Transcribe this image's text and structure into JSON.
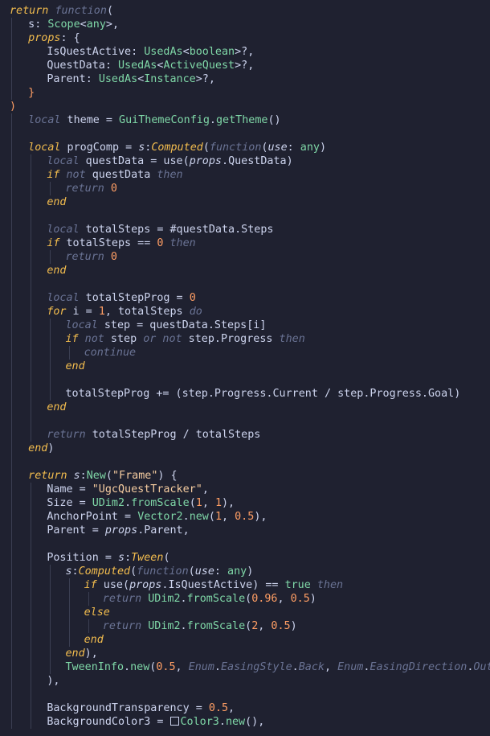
{
  "colors": {
    "background": "#1f2130",
    "text": "#cdd4ee",
    "keyword": "#f3bd4e",
    "muted_keyword": "#6a7394",
    "type": "#7fd7a7",
    "string": "#f5cca0",
    "number": "#ff9e64",
    "indent_guide": "#3b3f52"
  },
  "lines": [
    [
      [
        "return",
        "kw"
      ],
      [
        " "
      ],
      [
        "function",
        "kwd"
      ],
      [
        "("
      ]
    ],
    [
      [
        "s",
        "punc"
      ],
      [
        ": "
      ],
      [
        "Scope",
        "type"
      ],
      [
        "<"
      ],
      [
        "any",
        "type"
      ],
      [
        ">,"
      ]
    ],
    [
      [
        "props",
        "kw"
      ],
      [
        ": {"
      ]
    ],
    [
      [
        "IsQuestActive"
      ],
      [
        ": "
      ],
      [
        "UsedAs",
        "type"
      ],
      [
        "<"
      ],
      [
        "boolean",
        "type"
      ],
      [
        ">?,"
      ]
    ],
    [
      [
        "QuestData"
      ],
      [
        ": "
      ],
      [
        "UsedAs",
        "type"
      ],
      [
        "<"
      ],
      [
        "ActiveQuest",
        "type"
      ],
      [
        ">?,"
      ]
    ],
    [
      [
        "Parent"
      ],
      [
        ": "
      ],
      [
        "UsedAs",
        "type"
      ],
      [
        "<"
      ],
      [
        "Instance",
        "type"
      ],
      [
        ">?,"
      ]
    ],
    [
      [
        "}",
        "par"
      ]
    ],
    [
      [
        ")",
        "par"
      ]
    ],
    [
      [
        "local",
        "kwd"
      ],
      [
        " theme = "
      ],
      [
        "GuiThemeConfig",
        "type"
      ],
      [
        "."
      ],
      [
        "getTheme",
        "fn"
      ],
      [
        "()"
      ]
    ],
    [],
    [
      [
        "local",
        "kw"
      ],
      [
        " progComp = "
      ],
      [
        "s",
        "ital"
      ],
      [
        ":"
      ],
      [
        "Computed",
        "kw"
      ],
      [
        "("
      ],
      [
        "function",
        "kwd"
      ],
      [
        "("
      ],
      [
        "use",
        "ital"
      ],
      [
        ": "
      ],
      [
        "any",
        "type"
      ],
      [
        ")"
      ]
    ],
    [
      [
        "local",
        "kwd"
      ],
      [
        " questData = use("
      ],
      [
        "props",
        "ital"
      ],
      [
        "."
      ],
      [
        "QuestData"
      ],
      [
        ")"
      ]
    ],
    [
      [
        "if",
        "kw"
      ],
      [
        " "
      ],
      [
        "not",
        "kwd"
      ],
      [
        " questData "
      ],
      [
        "then",
        "kwd"
      ]
    ],
    [
      [
        "return",
        "kwd"
      ],
      [
        " "
      ],
      [
        "0",
        "num"
      ]
    ],
    [
      [
        "end",
        "kw"
      ]
    ],
    [],
    [
      [
        "local",
        "kwd"
      ],
      [
        " totalSteps = #questData."
      ],
      [
        "Steps"
      ]
    ],
    [
      [
        "if",
        "kw"
      ],
      [
        " totalSteps == "
      ],
      [
        "0",
        "num"
      ],
      [
        " "
      ],
      [
        "then",
        "kwd"
      ]
    ],
    [
      [
        "return",
        "kwd"
      ],
      [
        " "
      ],
      [
        "0",
        "num"
      ]
    ],
    [
      [
        "end",
        "kw"
      ]
    ],
    [],
    [
      [
        "local",
        "kwd"
      ],
      [
        " totalStepProg = "
      ],
      [
        "0",
        "num"
      ]
    ],
    [
      [
        "for",
        "kw"
      ],
      [
        " i = "
      ],
      [
        "1",
        "num"
      ],
      [
        ", totalSteps "
      ],
      [
        "do",
        "kwd"
      ]
    ],
    [
      [
        "local",
        "kwd"
      ],
      [
        " step = questData."
      ],
      [
        "Steps"
      ],
      [
        "[i]"
      ]
    ],
    [
      [
        "if",
        "kw"
      ],
      [
        " "
      ],
      [
        "not",
        "kwd"
      ],
      [
        " step "
      ],
      [
        "or",
        "kwd"
      ],
      [
        " "
      ],
      [
        "not",
        "kwd"
      ],
      [
        " step."
      ],
      [
        "Progress"
      ],
      [
        " "
      ],
      [
        "then",
        "kwd"
      ]
    ],
    [
      [
        "continue",
        "kwd"
      ]
    ],
    [
      [
        "end",
        "kw"
      ]
    ],
    [],
    [
      [
        "totalStepProg += (step."
      ],
      [
        "Progress"
      ],
      [
        "."
      ],
      [
        "Current"
      ],
      [
        " / step."
      ],
      [
        "Progress"
      ],
      [
        "."
      ],
      [
        "Goal"
      ],
      [
        ")"
      ]
    ],
    [
      [
        "end",
        "kw"
      ]
    ],
    [],
    [
      [
        "return",
        "kwd"
      ],
      [
        " totalStepProg / totalSteps"
      ]
    ],
    [
      [
        "end",
        "kw"
      ],
      [
        ")"
      ]
    ],
    [],
    [
      [
        "return",
        "kw"
      ],
      [
        " "
      ],
      [
        "s",
        "ital"
      ],
      [
        ":"
      ],
      [
        "New",
        "fn"
      ],
      [
        "("
      ],
      [
        "\"Frame\"",
        "str"
      ],
      [
        ") {"
      ]
    ],
    [
      [
        "Name = "
      ],
      [
        "\"UgcQuestTracker\"",
        "str"
      ],
      [
        ","
      ]
    ],
    [
      [
        "Size = "
      ],
      [
        "UDim2",
        "type"
      ],
      [
        "."
      ],
      [
        "fromScale",
        "fn"
      ],
      [
        "("
      ],
      [
        "1",
        "num"
      ],
      [
        ", "
      ],
      [
        "1",
        "num"
      ],
      [
        "),"
      ]
    ],
    [
      [
        "AnchorPoint = "
      ],
      [
        "Vector2",
        "type"
      ],
      [
        "."
      ],
      [
        "new",
        "fn"
      ],
      [
        "("
      ],
      [
        "1",
        "num"
      ],
      [
        ", "
      ],
      [
        "0.5",
        "num"
      ],
      [
        "),"
      ]
    ],
    [
      [
        "Parent = "
      ],
      [
        "props",
        "ital"
      ],
      [
        "."
      ],
      [
        "Parent"
      ],
      [
        ","
      ]
    ],
    [],
    [
      [
        "Position = "
      ],
      [
        "s",
        "ital"
      ],
      [
        ":"
      ],
      [
        "Tween",
        "kw"
      ],
      [
        "("
      ]
    ],
    [
      [
        "s",
        "ital"
      ],
      [
        ":"
      ],
      [
        "Computed",
        "kw"
      ],
      [
        "("
      ],
      [
        "function",
        "kwd"
      ],
      [
        "("
      ],
      [
        "use",
        "ital"
      ],
      [
        ": "
      ],
      [
        "any",
        "type"
      ],
      [
        ")"
      ]
    ],
    [
      [
        "if",
        "kw"
      ],
      [
        " use("
      ],
      [
        "props",
        "ital"
      ],
      [
        "."
      ],
      [
        "IsQuestActive"
      ],
      [
        ") == "
      ],
      [
        "true",
        "type"
      ],
      [
        " "
      ],
      [
        "then",
        "kwd"
      ]
    ],
    [
      [
        "return",
        "kwd"
      ],
      [
        " "
      ],
      [
        "UDim2",
        "type"
      ],
      [
        "."
      ],
      [
        "fromScale",
        "fn"
      ],
      [
        "("
      ],
      [
        "0.96",
        "num"
      ],
      [
        ", "
      ],
      [
        "0.5",
        "num"
      ],
      [
        ")"
      ]
    ],
    [
      [
        "else",
        "kw"
      ]
    ],
    [
      [
        "return",
        "kwd"
      ],
      [
        " "
      ],
      [
        "UDim2",
        "type"
      ],
      [
        "."
      ],
      [
        "fromScale",
        "fn"
      ],
      [
        "("
      ],
      [
        "2",
        "num"
      ],
      [
        ", "
      ],
      [
        "0.5",
        "num"
      ],
      [
        ")"
      ]
    ],
    [
      [
        "end",
        "kw"
      ]
    ],
    [
      [
        "end",
        "kw"
      ],
      [
        "),"
      ]
    ],
    [
      [
        "TweenInfo",
        "type"
      ],
      [
        "."
      ],
      [
        "new",
        "fn"
      ],
      [
        "("
      ],
      [
        "0.5",
        "num"
      ],
      [
        ", "
      ],
      [
        "Enum",
        "kwd"
      ],
      [
        "."
      ],
      [
        "EasingStyle",
        "kwd"
      ],
      [
        "."
      ],
      [
        "Back",
        "kwd"
      ],
      [
        ", "
      ],
      [
        "Enum",
        "kwd"
      ],
      [
        "."
      ],
      [
        "EasingDirection",
        "kwd"
      ],
      [
        "."
      ],
      [
        "Out",
        "kwd"
      ],
      [
        ")"
      ]
    ],
    [
      [
        "),"
      ]
    ],
    [],
    [
      [
        "BackgroundTransparency = "
      ],
      [
        "0.5",
        "num"
      ],
      [
        ","
      ]
    ],
    [
      [
        "BackgroundColor3 = "
      ],
      [
        "■",
        "swatch"
      ],
      [
        "Color3",
        "type"
      ],
      [
        "."
      ],
      [
        "new",
        "fn"
      ],
      [
        "(),"
      ]
    ]
  ]
}
